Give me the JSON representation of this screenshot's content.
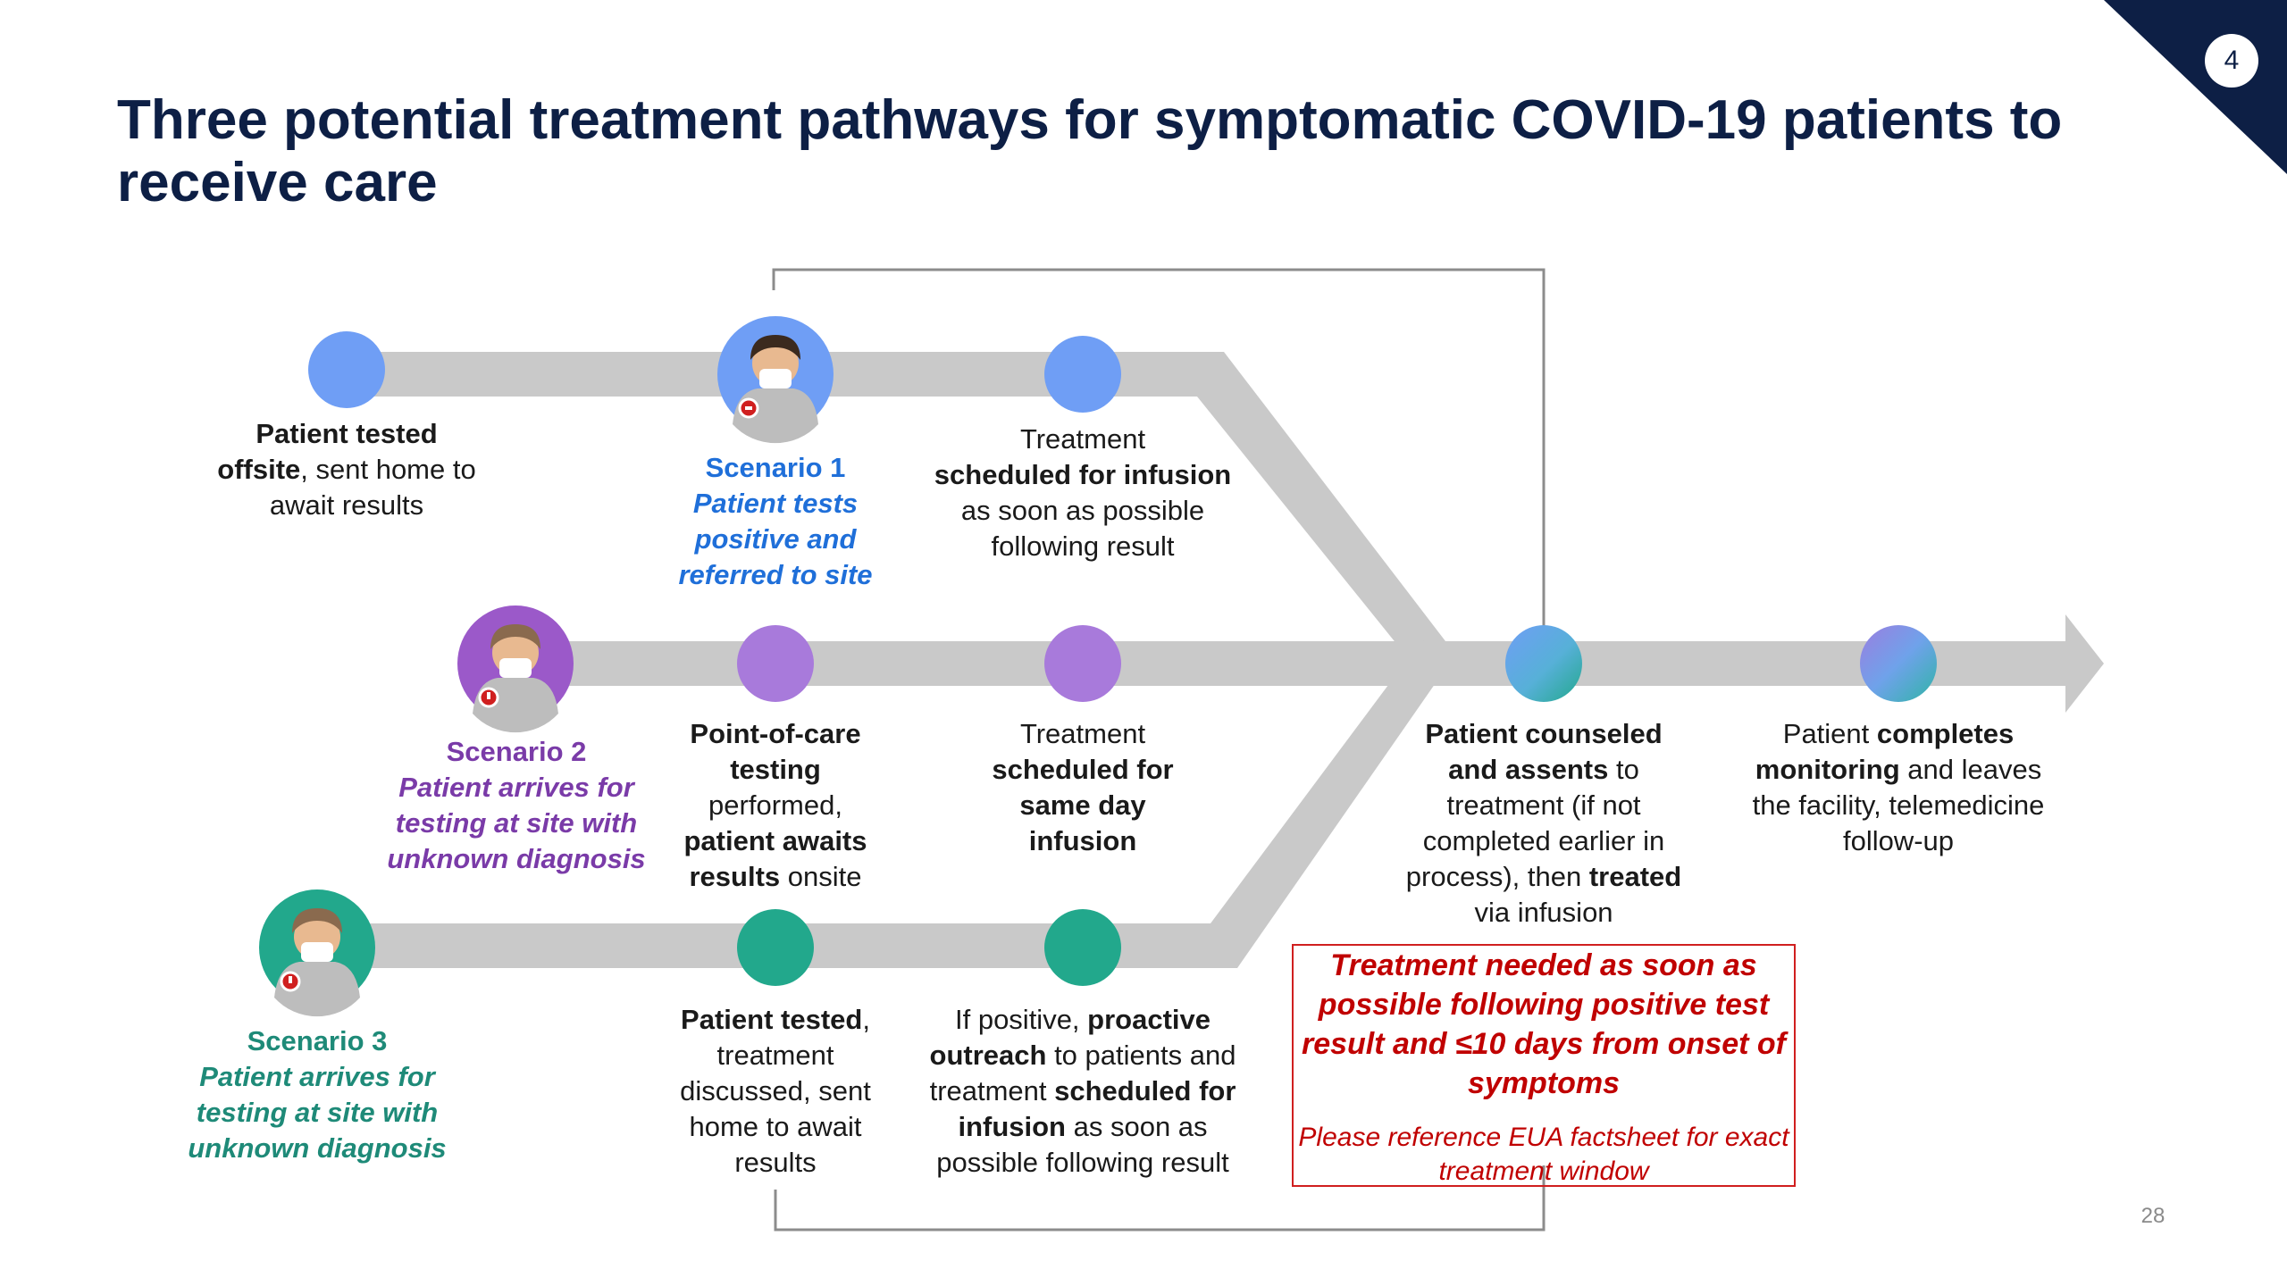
{
  "slide": {
    "title": "Three potential treatment pathways for symptomatic COVID-19 patients to receive care",
    "page_badge": "4",
    "slide_number": "28"
  },
  "colors": {
    "navy": "#0d1f45",
    "track": "#c9c9c9",
    "blue": "#6f9ef5",
    "purple": "#a87adb",
    "teal": "#22a88c",
    "scenario1_text": "#1f6fd9",
    "scenario2_text": "#7a3ba8",
    "scenario3_text": "#1e8a78",
    "alert_red": "#c00000"
  },
  "scenarios": [
    {
      "title": "Scenario 1",
      "desc": "Patient tests positive and referred to site",
      "icon": "patient-avatar-icon"
    },
    {
      "title": "Scenario 2",
      "desc": "Patient arrives for testing at site with unknown diagnosis",
      "icon": "patient-avatar-icon"
    },
    {
      "title": "Scenario 3",
      "desc": "Patient arrives for testing at site with unknown diagnosis",
      "icon": "patient-avatar-icon"
    }
  ],
  "steps": {
    "s1_tested": {
      "b1": "Patient tested",
      "b2": "offsite",
      "t1": ", sent home to await results"
    },
    "s1_treatment": {
      "t1": "Treatment",
      "b1": "scheduled for infusion",
      "t2": " as soon as possible following result"
    },
    "s2_poc": {
      "b1": "Point-of-care testing",
      "t1": "performed,",
      "b2": "patient awaits results",
      "t2": " onsite"
    },
    "s2_treatment": {
      "t1": "Treatment",
      "b1": "scheduled for same day infusion"
    },
    "s3_tested": {
      "b1": "Patient tested",
      "t1": ", treatment discussed, sent home to await results"
    },
    "s3_outreach": {
      "t1": "If positive, ",
      "b1": "proactive outreach",
      "t2": " to patients and treatment ",
      "b2": "scheduled for infusion",
      "t3": " as soon as possible following result"
    },
    "counseled": {
      "b1": "Patient counseled and assents",
      "t1": " to treatment (if not completed earlier in process), then ",
      "b2": "treated",
      "t2": " via infusion"
    },
    "completes": {
      "t1": "Patient ",
      "b1": "completes monitoring",
      "t2": " and leaves the facility, telemedicine follow-up"
    }
  },
  "alert": {
    "main": "Treatment needed as soon as possible following positive test result and ≤10 days from onset of symptoms",
    "sub": "Please reference EUA factsheet for exact treatment window"
  }
}
